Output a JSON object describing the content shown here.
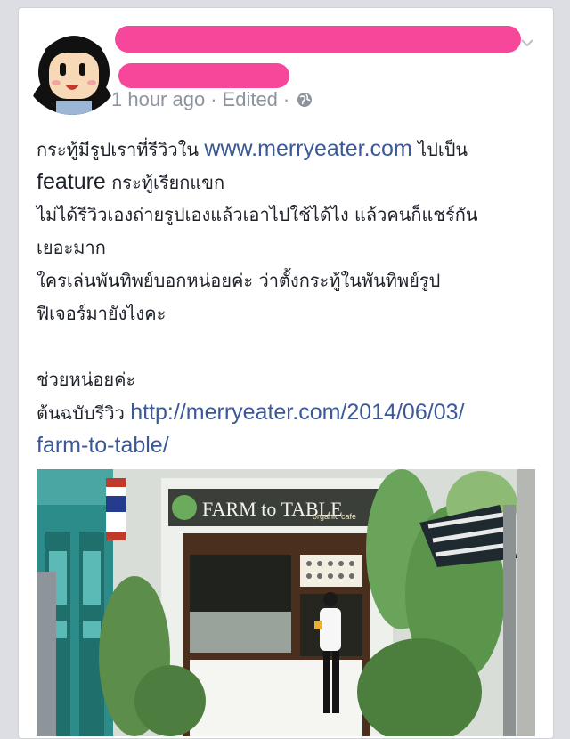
{
  "post": {
    "time": "1 hour ago",
    "edited": "Edited",
    "separator": "·",
    "lines": [
      {
        "parts": [
          {
            "t": "กระทู้มีรูปเราที่รีวิวใน "
          },
          {
            "t": "www.merryeater.com",
            "c": "link"
          },
          {
            "t": " ไปเป็น"
          }
        ]
      },
      {
        "parts": [
          {
            "t": "feature",
            "c": "en"
          },
          {
            "t": " กระทู้เรียกแขก"
          }
        ]
      },
      {
        "parts": [
          {
            "t": "ไม่ได้รีวิวเองถ่ายรูปเองแล้วเอาไปใช้ได้ไง แล้วคนก็แชร์กัน"
          }
        ]
      },
      {
        "parts": [
          {
            "t": "เยอะมาก"
          }
        ]
      },
      {
        "parts": [
          {
            "t": "ใครเล่นพันทิพย์บอกหน่อยค่ะ ว่าตั้งกระทู้ในพันทิพย์รูป"
          }
        ]
      },
      {
        "parts": [
          {
            "t": "ฟีเจอร์มายังไงคะ"
          }
        ]
      },
      {
        "parts": [
          {
            "t": ""
          }
        ]
      },
      {
        "parts": [
          {
            "t": "ช่วยหน่อยค่ะ"
          }
        ]
      },
      {
        "parts": [
          {
            "t": "ต้นฉบับรีวิว "
          },
          {
            "t": "http://merryeater.com/2014/06/03/",
            "c": "link"
          }
        ]
      },
      {
        "parts": [
          {
            "t": "farm-to-table/",
            "c": "link"
          }
        ]
      }
    ],
    "photo": {
      "sign_text": "FARM to TABLE",
      "sign_sub": "organic cafe"
    }
  },
  "colors": {
    "link": "#3b5998",
    "redaction": "#f7479a",
    "meta": "#8d949e"
  },
  "icons": [
    "avatar",
    "chevron-down-icon",
    "globe-icon"
  ]
}
